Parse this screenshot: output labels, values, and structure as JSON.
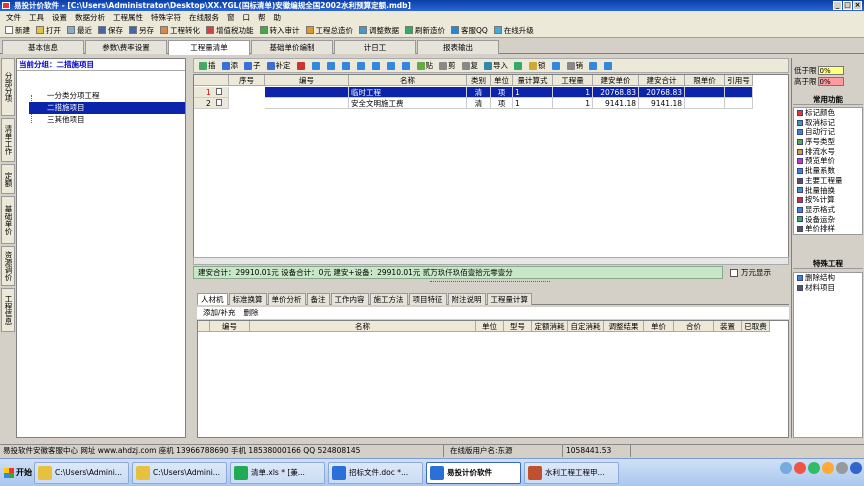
{
  "window": {
    "title": "易投计价软件 - [C:\\Users\\Administrator\\Desktop\\XX.YGL(国标清单)安徽编规全国2002水利预算定额.mdb]",
    "controls": [
      "_",
      "□",
      "×"
    ]
  },
  "menu": [
    "文件",
    "工具",
    "设置",
    "数据分析",
    "工程属性",
    "特殊字符",
    "在线服务",
    "窗",
    "口",
    "帮",
    "助"
  ],
  "toolbar": [
    {
      "label": "新建",
      "icon": "new-file-icon"
    },
    {
      "label": "打开",
      "icon": "open-folder-icon"
    },
    {
      "label": "最近",
      "icon": "recent-icon"
    },
    {
      "label": "保存",
      "icon": "save-icon"
    },
    {
      "label": "另存",
      "icon": "save-as-icon"
    },
    {
      "label": "工程转化",
      "icon": "convert-icon"
    },
    {
      "label": "增值税功能",
      "icon": "tax-icon"
    },
    {
      "label": "转入审计",
      "icon": "audit-icon"
    },
    {
      "label": "工程总造价",
      "icon": "total-cost-icon"
    },
    {
      "label": "调整数据",
      "icon": "adjust-icon"
    },
    {
      "label": "刷新造价",
      "icon": "refresh-icon"
    },
    {
      "label": "客服QQ",
      "icon": "qq-icon"
    },
    {
      "label": "在线升级",
      "icon": "upgrade-icon"
    }
  ],
  "tabs": [
    "基本信息",
    "参数\\费率设置",
    "工程量清单",
    "基础单价编制",
    "计日工",
    "报表输出"
  ],
  "active_tab": 2,
  "vtabs": [
    "分部分项",
    "清单工作",
    "定额",
    "基础单价",
    "资源调价",
    "工程信息"
  ],
  "left": {
    "current_group": "当前分组：二措施项目",
    "tree": [
      {
        "label": "一分类分项工程",
        "selected": false
      },
      {
        "label": "二措施项目",
        "selected": true
      },
      {
        "label": "三其他项目",
        "selected": false
      }
    ]
  },
  "grid_toolbar": [
    "插",
    "添",
    "子",
    "补定",
    "",
    "",
    "",
    "",
    "",
    "",
    "",
    "",
    "贴",
    "剪",
    "复",
    "导入",
    "",
    "锁",
    "",
    "销",
    "",
    ""
  ],
  "grid": {
    "columns": [
      "序号",
      "编号",
      "名称",
      "类别",
      "单位",
      "量计算式",
      "工程量",
      "建安单价",
      "建安合计",
      "限单价",
      "引用号"
    ],
    "rows": [
      {
        "seq": "1",
        "code": "",
        "name": "临时工程",
        "type": "清",
        "unit": "项",
        "formula": "1",
        "qty": "1",
        "price": "20768.83",
        "total": "20768.83",
        "limit": "",
        "ref": ""
      },
      {
        "seq": "2",
        "code": "",
        "name": "安全文明施工费",
        "type": "清",
        "unit": "项",
        "formula": "1",
        "qty": "1",
        "price": "9141.18",
        "total": "9141.18",
        "limit": "",
        "ref": ""
      }
    ]
  },
  "summary": "建安合计：29910.01元  设备合计：0元  建安+设备：29910.01元   贰万玖仟玖佰壹拾元零壹分",
  "wan_yuan": "万元显示",
  "bottom_tabs": [
    "人材机",
    "标准换算",
    "单价分析",
    "备注",
    "工作内容",
    "施工方法",
    "项目特征",
    "附注说明",
    "工程量计算"
  ],
  "bottom_actions": [
    "添加/补充",
    "删除"
  ],
  "bottom_columns": [
    "编号",
    "名称",
    "单位",
    "型号",
    "定额消耗",
    "自定消耗",
    "调整结果",
    "单价",
    "合价",
    "装置",
    "已取费"
  ],
  "right": {
    "low_limit_label": "低于限",
    "low_limit_value": "0%",
    "high_limit_label": "高于限",
    "high_limit_value": "0%",
    "common_title": "常用功能",
    "common": [
      "标记颜色",
      "取消标记",
      "自动行记",
      "序号类型",
      "排流水号",
      "预览单价",
      "批量系数",
      "主要工程量",
      "批量抽换",
      "按%计算",
      "显示格式",
      "设备运杂",
      "单价排样"
    ],
    "special_title": "特殊工程",
    "special": [
      "删除结构",
      "材料项目"
    ]
  },
  "status": {
    "company": "易投软件安徽客服中心  网址 www.ahdzj.com  座机 13966788690  手机 18538000166  QQ 524808145",
    "user": "在线版用户名:东源",
    "number": "1058441.53"
  },
  "taskbar": {
    "start": "开始",
    "items": [
      {
        "label": "C:\\Users\\Admini...",
        "color": "#e8c040",
        "active": false
      },
      {
        "label": "C:\\Users\\Admini...",
        "color": "#e8c040",
        "active": false
      },
      {
        "label": "清单.xls * [兼...",
        "color": "#22aa55",
        "active": false
      },
      {
        "label": "招标文件.doc *...",
        "color": "#2b6fd8",
        "active": false
      },
      {
        "label": "易投计价软件",
        "color": "#2b6fd8",
        "active": true
      },
      {
        "label": "水利工程工程甲...",
        "color": "#c05030",
        "active": false
      }
    ]
  }
}
